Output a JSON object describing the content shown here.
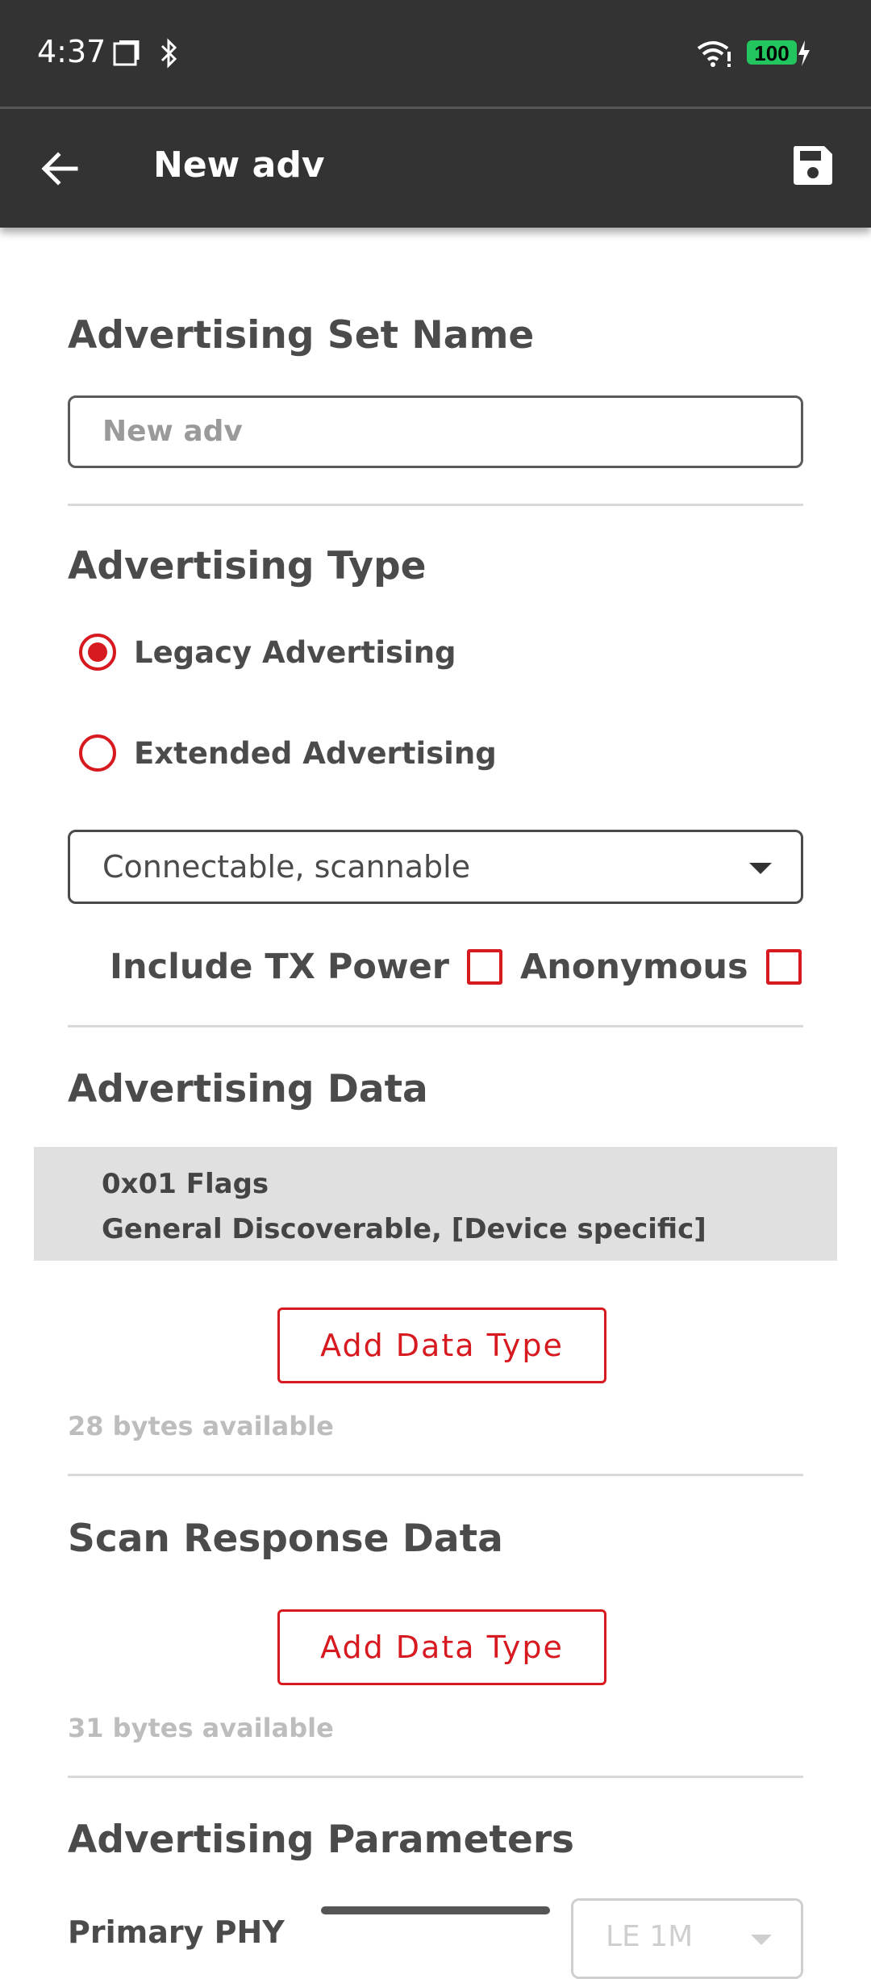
{
  "status_bar": {
    "time": "4:37",
    "battery": "100",
    "icons": [
      "screenshot-icon",
      "bluetooth-icon",
      "wifi-icon",
      "battery-charging-icon"
    ]
  },
  "app_bar": {
    "title": "New adv",
    "back_icon": "arrow-back-icon",
    "save_icon": "save-icon"
  },
  "advertising_set_name": {
    "title": "Advertising Set Name",
    "value": "New adv"
  },
  "advertising_type": {
    "title": "Advertising Type",
    "options": [
      {
        "label": "Legacy Advertising",
        "selected": true
      },
      {
        "label": "Extended Advertising",
        "selected": false
      }
    ],
    "mode": "Connectable, scannable",
    "include_tx_power_label": "Include TX Power",
    "include_tx_power_checked": false,
    "anonymous_label": "Anonymous",
    "anonymous_checked": false
  },
  "advertising_data": {
    "title": "Advertising Data",
    "items": [
      {
        "type": "0x01 Flags",
        "value": "General Discoverable, [Device specific]"
      }
    ],
    "add_button": "Add Data Type",
    "bytes_available": "28 bytes available"
  },
  "scan_response_data": {
    "title": "Scan Response Data",
    "add_button": "Add Data Type",
    "bytes_available": "31 bytes available"
  },
  "advertising_parameters": {
    "title": "Advertising Parameters",
    "primary_phy_label": "Primary PHY",
    "primary_phy_value": "LE 1M"
  },
  "colors": {
    "accent": "#d71920",
    "app_bar": "#333333",
    "battery": "#22c55e"
  }
}
